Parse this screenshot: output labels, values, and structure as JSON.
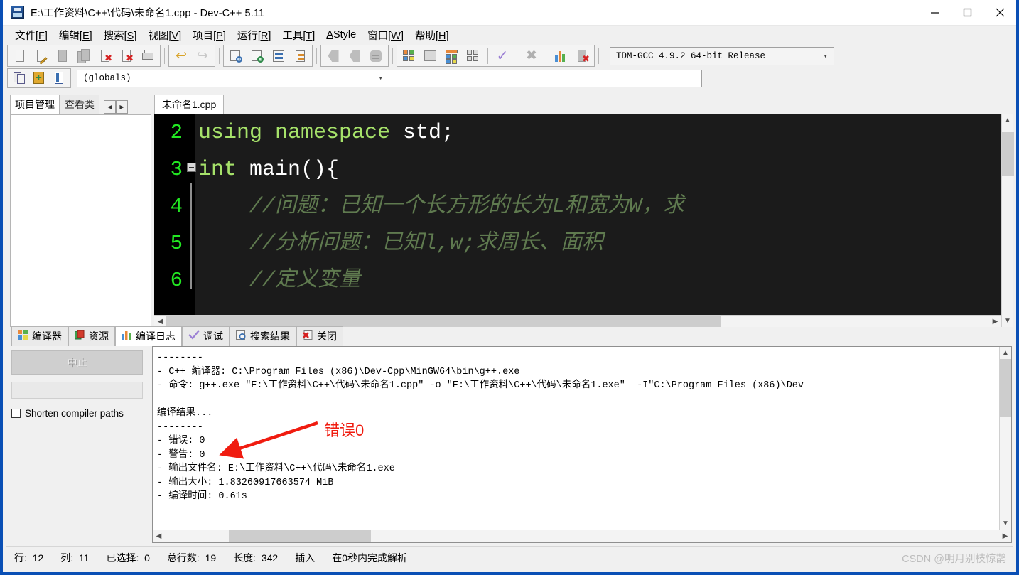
{
  "window": {
    "title": "E:\\工作资料\\C++\\代码\\未命名1.cpp - Dev-C++ 5.11",
    "minimize": "minimize-button",
    "maximize": "maximize-button",
    "close": "close-button"
  },
  "menubar": [
    {
      "label": "文件",
      "mnemonic": "[F]"
    },
    {
      "label": "编辑",
      "mnemonic": "[E]"
    },
    {
      "label": "搜索",
      "mnemonic": "[S]"
    },
    {
      "label": "视图",
      "mnemonic": "[V]"
    },
    {
      "label": "项目",
      "mnemonic": "[P]"
    },
    {
      "label": "运行",
      "mnemonic": "[R]"
    },
    {
      "label": "工具",
      "mnemonic": "[T]"
    },
    {
      "label": "AStyle",
      "mnemonic": ""
    },
    {
      "label": "窗口",
      "mnemonic": "[W]"
    },
    {
      "label": "帮助",
      "mnemonic": "[H]"
    }
  ],
  "toolbar": {
    "compiler_selector": "TDM-GCC 4.9.2 64-bit Release",
    "scope_selector": "(globals)",
    "scope_secondary": ""
  },
  "left_panel": {
    "tabs": [
      {
        "label": "项目管理",
        "active": true
      },
      {
        "label": "查看类",
        "active": false
      }
    ],
    "nav_prev": "◀",
    "nav_next": "▶"
  },
  "editor": {
    "tab": "未命名1.cpp",
    "lines": [
      {
        "num": "2",
        "segments": [
          {
            "t": "using namespace ",
            "c": "kw"
          },
          {
            "t": "std;",
            "c": "wh"
          }
        ]
      },
      {
        "num": "3",
        "segments": [
          {
            "t": "int",
            "c": "kw"
          },
          {
            "t": " main(){",
            "c": "wh"
          }
        ]
      },
      {
        "num": "4",
        "segments": [
          {
            "t": "    //问题：已知一个长方形的长为L和宽为W，求",
            "c": "cmt"
          }
        ]
      },
      {
        "num": "5",
        "segments": [
          {
            "t": "    //分析问题：已知l,w;求周长、面积",
            "c": "cmt"
          }
        ]
      },
      {
        "num": "6",
        "segments": [
          {
            "t": "    //定义变量",
            "c": "cmt"
          }
        ]
      }
    ]
  },
  "bottom_panel": {
    "tabs": [
      {
        "label": "编译器",
        "icon": "grid-squares-icon",
        "active": false
      },
      {
        "label": "资源",
        "icon": "copy-pages-icon",
        "active": false
      },
      {
        "label": "编译日志",
        "icon": "bar-chart-icon",
        "active": true
      },
      {
        "label": "调试",
        "icon": "check-icon",
        "active": false
      },
      {
        "label": "搜索结果",
        "icon": "magnifier-icon",
        "active": false
      },
      {
        "label": "关闭",
        "icon": "red-x-icon",
        "active": false
      }
    ],
    "abort_button": "中止",
    "shorten_paths_label": "Shorten compiler paths",
    "log": "--------\n- C++ 编译器: C:\\Program Files (x86)\\Dev-Cpp\\MinGW64\\bin\\g++.exe\n- 命令: g++.exe \"E:\\工作资料\\C++\\代码\\未命名1.cpp\" -o \"E:\\工作资料\\C++\\代码\\未命名1.exe\"  -I\"C:\\Program Files (x86)\\Dev\n\n编译结果...\n--------\n- 错误: 0\n- 警告: 0\n- 输出文件名: E:\\工作资料\\C++\\代码\\未命名1.exe\n- 输出大小: 1.83260917663574 MiB\n- 编译时间: 0.61s"
  },
  "annotation": {
    "label": "错误0",
    "color": "#f01c10"
  },
  "statusbar": {
    "items": [
      {
        "label": "行:",
        "value": "12"
      },
      {
        "label": "列:",
        "value": "11"
      },
      {
        "label": "已选择:",
        "value": "0"
      },
      {
        "label": "总行数:",
        "value": "19"
      },
      {
        "label": "长度:",
        "value": "342"
      },
      {
        "label": "插入",
        "value": ""
      },
      {
        "label": "在0秒内完成解析",
        "value": ""
      }
    ],
    "watermark": "CSDN @明月别枝惊鹊"
  }
}
